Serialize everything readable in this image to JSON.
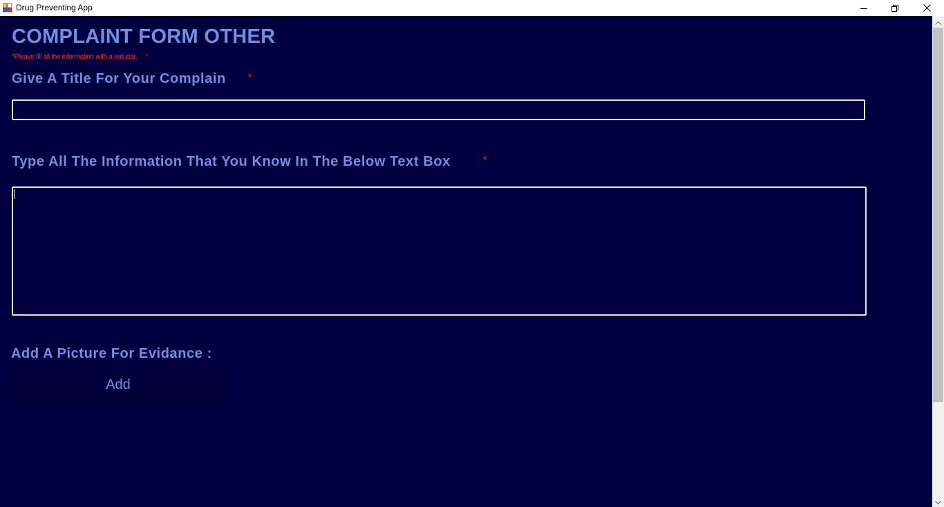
{
  "window": {
    "title": "Drug Preventing App",
    "icon": "app-icon",
    "controls": {
      "minimize": "minimize-icon",
      "maximize": "restore-icon",
      "close": "close-icon"
    }
  },
  "form": {
    "heading": "COMPLAINT FORM OTHER",
    "note": "*Please fill all the information with a red star.",
    "note_star": "*",
    "title_field": {
      "label": "Give A Title For Your Complain",
      "required_marker": "*",
      "value": "",
      "placeholder": ""
    },
    "info_field": {
      "label": "Type All The Information That You Know In The Below Text Box",
      "required_marker": "*",
      "value": "",
      "placeholder": ""
    },
    "picture": {
      "label": "Add A Picture For Evidance :",
      "button_label": "Add"
    }
  },
  "colors": {
    "background": "#00003f",
    "label": "#6f8fe0",
    "required": "#ff2a2a",
    "field_border": "#e8e8e8"
  }
}
